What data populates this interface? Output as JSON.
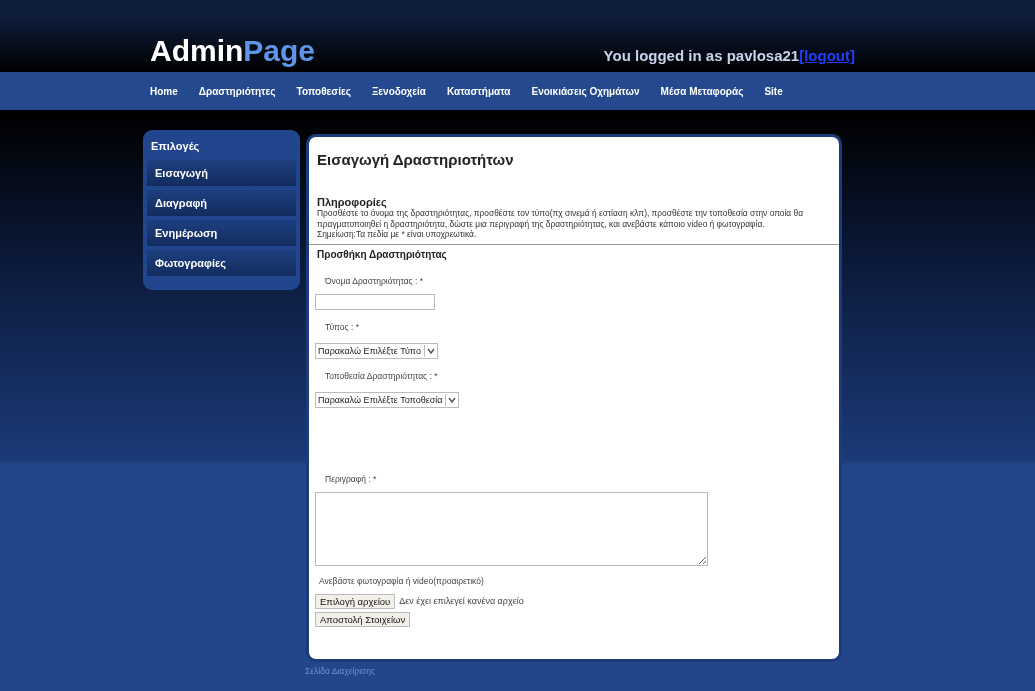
{
  "header": {
    "logo": {
      "first": "Admin",
      "second": "Page"
    },
    "login_text": "You logged in as pavlosa21",
    "logout_link": "[logout]"
  },
  "nav": [
    {
      "label": "Home"
    },
    {
      "label": "Δραστηριότητες"
    },
    {
      "label": "Τοποθεσίες"
    },
    {
      "label": "Ξενοδοχεία"
    },
    {
      "label": "Καταστήματα"
    },
    {
      "label": "Ενοικιάσεις Οχημάτων"
    },
    {
      "label": "Μέσα Μεταφοράς"
    },
    {
      "label": "Site"
    }
  ],
  "sidebar": {
    "title": "Επιλογές",
    "items": [
      {
        "label": "Εισαγωγή"
      },
      {
        "label": "Διαγραφή"
      },
      {
        "label": "Ενημέρωση"
      },
      {
        "label": "Φωτογραφίες"
      }
    ]
  },
  "main": {
    "title": "Εισαγωγή Δραστηριοτήτων",
    "info_heading": "Πληροφορίες",
    "info_text": "Προσθέστε το όνομα της δραστηριότητας, προσθέστε τον τύπο(πχ σινεμά ή εστίαση κλπ), προσθέστε την τοποθεσία στην οποία θα πραγματοποιηθεί η δραστηριότητα, δώστε μια περιγραφή της δραστηριότητας, και ανεβάστε κάποιο video ή φωτογραφία.",
    "note": "Σημείωση:Τα πεδία με * είναι υποχρεωτικά.",
    "form_heading": "Προσθήκη Δραστηριότητας",
    "fields": [
      {
        "kind": "text",
        "label": "Όνομα Δραστηριότητας : *"
      },
      {
        "kind": "select",
        "label": "Τύπος : *",
        "value": "Παρακαλώ Επιλέξτε Τύπο"
      },
      {
        "kind": "select",
        "label": "Τοποθεσία Δραστηριότητας : *",
        "value": "Παρακαλώ Επιλέξτε Τοποθεσία"
      },
      {
        "kind": "textarea",
        "label": "Περιγραφή : *"
      }
    ],
    "upload_label": "Ανεβάστε φωτογραφία ή video(προαιρετικό)",
    "file_button": "Επιλογή αρχείου",
    "file_status": "Δεν έχει επιλεγεί κανένα αρχείο",
    "submit_button": "Αποστολή Στοιχείων"
  },
  "footer": "Σελίδα Διαχείρισης"
}
